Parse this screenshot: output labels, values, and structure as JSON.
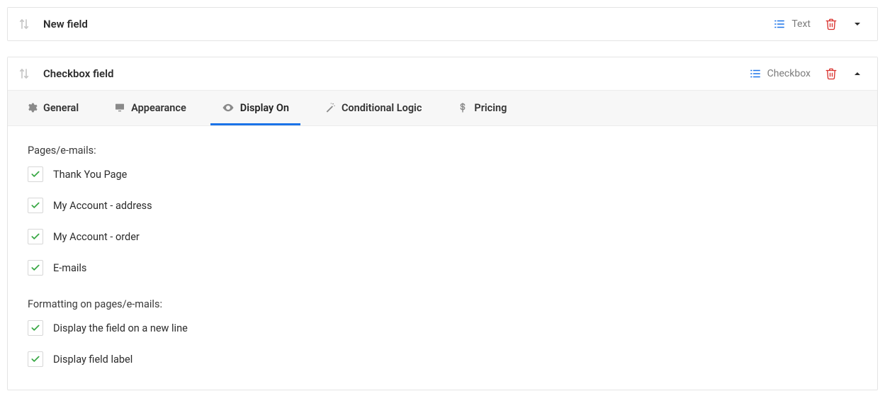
{
  "fields": [
    {
      "title": "New field",
      "type_label": "Text",
      "expanded": false
    },
    {
      "title": "Checkbox field",
      "type_label": "Checkbox",
      "expanded": true
    }
  ],
  "tabs": {
    "general": "General",
    "appearance": "Appearance",
    "display_on": "Display On",
    "conditional_logic": "Conditional Logic",
    "pricing": "Pricing"
  },
  "display_on_panel": {
    "section1_label": "Pages/e-mails:",
    "options1": [
      "Thank You Page",
      "My Account - address",
      "My Account - order",
      "E-mails"
    ],
    "section2_label": "Formatting on pages/e-mails:",
    "options2": [
      "Display the field on a new line",
      "Display field label"
    ]
  }
}
